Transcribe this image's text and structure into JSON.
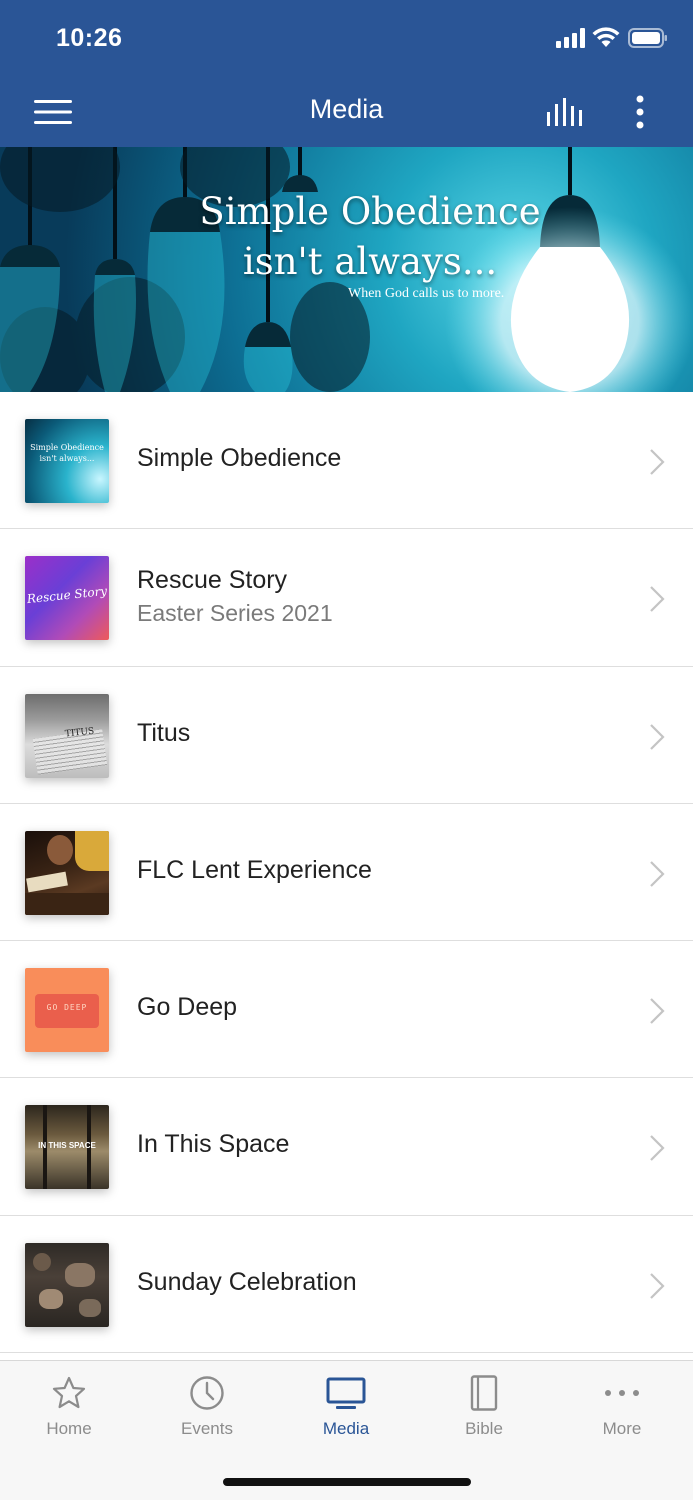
{
  "status_bar": {
    "time": "10:26"
  },
  "header": {
    "title": "Media"
  },
  "banner": {
    "title_line1": "Simple Obedience",
    "title_line2": "isn't always...",
    "subtitle": "When God calls us to more."
  },
  "list": [
    {
      "title": "Simple Obedience",
      "subtitle": ""
    },
    {
      "title": "Rescue Story",
      "subtitle": "Easter Series 2021"
    },
    {
      "title": "Titus",
      "subtitle": ""
    },
    {
      "title": "FLC Lent Experience",
      "subtitle": ""
    },
    {
      "title": "Go Deep",
      "subtitle": ""
    },
    {
      "title": "In This Space",
      "subtitle": ""
    },
    {
      "title": "Sunday Celebration",
      "subtitle": ""
    }
  ],
  "thumbnails": {
    "simple_obedience": {
      "line1": "Simple Obedience",
      "line2": "isn't always..."
    },
    "rescue_story": {
      "text": "Rescue Story"
    },
    "titus": {
      "text": "TITUS"
    },
    "go_deep": {
      "text": "GO DEEP"
    },
    "in_this_space": {
      "text": "IN THIS SPACE"
    }
  },
  "tabs": [
    {
      "label": "Home",
      "icon": "star-icon"
    },
    {
      "label": "Events",
      "icon": "clock-icon"
    },
    {
      "label": "Media",
      "icon": "tv-icon",
      "active": true
    },
    {
      "label": "Bible",
      "icon": "book-icon"
    },
    {
      "label": "More",
      "icon": "ellipsis-icon"
    }
  ],
  "colors": {
    "header": "#2a5596",
    "active_tab": "#2a5596",
    "inactive_tab": "#8c8c8c"
  }
}
